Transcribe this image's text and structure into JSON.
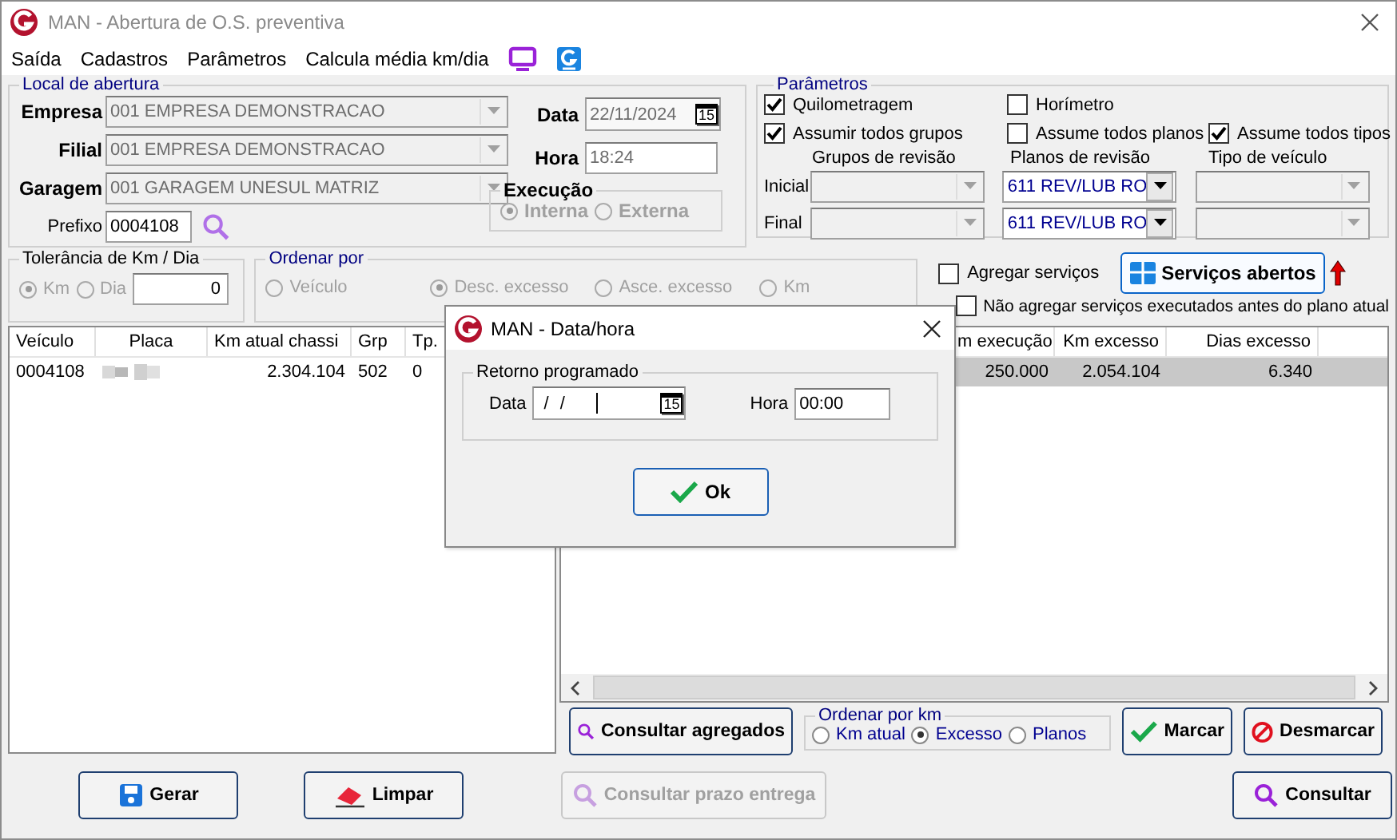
{
  "window": {
    "title": "MAN - Abertura de O.S. preventiva"
  },
  "menu": [
    "Saída",
    "Cadastros",
    "Parâmetros",
    "Calcula média km/dia"
  ],
  "local": {
    "title": "Local de abertura",
    "fields": [
      {
        "label": "Empresa",
        "value": "001 EMPRESA DEMONSTRACAO",
        "disabled": true
      },
      {
        "label": "Filial",
        "value": "001 EMPRESA DEMONSTRACAO",
        "disabled": true
      },
      {
        "label": "Garagem",
        "value": "001 GARAGEM UNESUL MATRIZ",
        "disabled": true
      }
    ],
    "prefixo": {
      "label": "Prefixo",
      "value": "0004108"
    },
    "data": {
      "label": "Data",
      "value": "22/11/2024",
      "calendar": "15"
    },
    "hora": {
      "label": "Hora",
      "value": "18:24"
    },
    "execucao": {
      "title": "Execução",
      "options": [
        {
          "label": "Interna",
          "selected": true
        },
        {
          "label": "Externa",
          "selected": false
        }
      ]
    }
  },
  "parametros": {
    "title": "Parâmetros",
    "check_rows": [
      [
        {
          "label": "Quilometragem",
          "checked": true
        },
        {
          "label": "Horímetro",
          "checked": false
        }
      ],
      [
        {
          "label": "Assumir todos grupos",
          "checked": true
        },
        {
          "label": "Assume todos planos",
          "checked": false
        },
        {
          "label": "Assume todos tipos",
          "checked": true
        }
      ]
    ],
    "columns": [
      "Grupos de revisão",
      "Planos de revisão",
      "Tipo de veículo"
    ],
    "rows": [
      {
        "label": "Inicial",
        "combos": [
          {
            "disabled": true
          },
          {
            "value": "611 REV/LUB RO",
            "disabled": false
          },
          {
            "disabled": true
          }
        ]
      },
      {
        "label": "Final",
        "combos": [
          {
            "disabled": true
          },
          {
            "value": "611 REV/LUB RO",
            "disabled": false
          },
          {
            "disabled": true
          }
        ]
      }
    ]
  },
  "tolerancia": {
    "title": "Tolerância de Km / Dia",
    "options": [
      {
        "label": "Km",
        "selected": true
      },
      {
        "label": "Dia",
        "selected": false
      }
    ],
    "value": "0"
  },
  "ordenar_por": {
    "title": "Ordenar por",
    "options": [
      {
        "label": "Veículo",
        "selected": false
      },
      {
        "label": "Desc. excesso",
        "selected": true
      },
      {
        "label": "Asce. excesso",
        "selected": false
      },
      {
        "label": "Km",
        "selected": false
      }
    ]
  },
  "agregar": [
    {
      "label": "Agregar serviços",
      "checked": false
    },
    {
      "label": "Não agregar serviços executados antes do plano atual",
      "checked": false
    }
  ],
  "servicos_button": {
    "label": "Serviços abertos"
  },
  "left_table": {
    "columns": [
      "Veículo",
      "Placa",
      "Km atual chassi",
      "Grp",
      "Tp."
    ],
    "rows": [
      {
        "selected": false,
        "cells": [
          {
            "kind": "text",
            "text": "0004108"
          },
          {
            "kind": "blurred"
          },
          {
            "kind": "number",
            "text": "2.304.104"
          },
          {
            "kind": "text",
            "text": "502"
          },
          {
            "kind": "text",
            "text": "0"
          }
        ]
      }
    ]
  },
  "right_table": {
    "columns": [
      "m execução",
      "Km excesso",
      "Dias excesso"
    ],
    "rows": [
      {
        "selected": true,
        "cells": [
          "250.000",
          "2.054.104",
          "6.340"
        ]
      }
    ]
  },
  "table_actions": [
    {
      "label": "Consultar agregados",
      "disabled": false
    }
  ],
  "ordenar_km": {
    "title": "Ordenar por km",
    "options": [
      {
        "label": "Km atual",
        "selected": false
      },
      {
        "label": "Excesso",
        "selected": true
      },
      {
        "label": "Planos",
        "selected": false
      }
    ]
  },
  "mark_buttons": [
    {
      "label": "Marcar",
      "disabled": false
    },
    {
      "label": "Desmarcar",
      "disabled": false
    }
  ],
  "bottom_buttons": [
    {
      "label": "Gerar",
      "disabled": false
    },
    {
      "label": "Limpar",
      "disabled": false
    },
    {
      "label": "Consultar prazo entrega",
      "disabled": true
    },
    {
      "label": "Consultar",
      "disabled": false
    }
  ],
  "dialog": {
    "title": "MAN - Data/hora",
    "group": "Retorno programado",
    "data": {
      "label": "Data",
      "value": "/ /",
      "calendar": "15"
    },
    "hora": {
      "label": "Hora",
      "value": "00:00"
    },
    "ok": {
      "label": "Ok"
    }
  }
}
